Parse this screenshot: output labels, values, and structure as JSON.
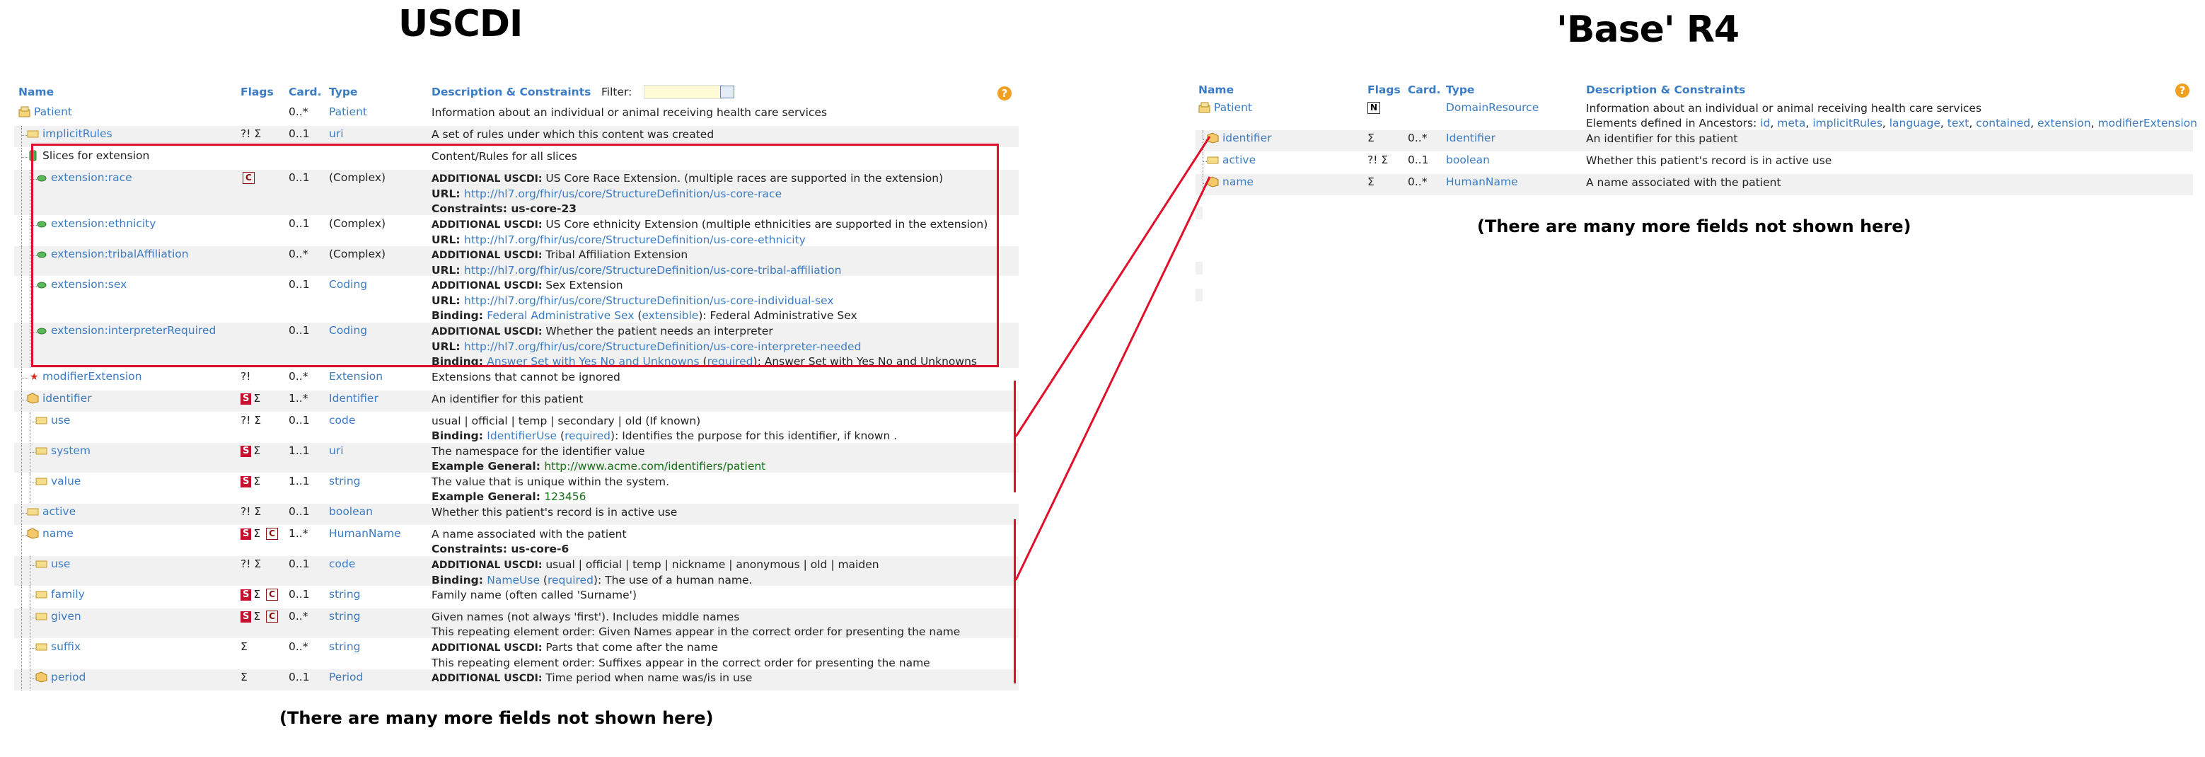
{
  "titles": {
    "left": "USCDI",
    "right": "'Base' R4"
  },
  "notes": {
    "left": "(There are many more fields not shown here)",
    "right": "(There are many more fields not shown here)"
  },
  "colors": {
    "link": "#3b7cc4",
    "highlight": "#e0102a",
    "flag_s": "#c8102e",
    "row_alt": "#f1f1f1"
  },
  "left_table": {
    "headers": {
      "name": "Name",
      "flags": "Flags",
      "card": "Card.",
      "type": "Type",
      "desc": "Description & Constraints",
      "filter": "Filter:"
    },
    "help_icon": "?",
    "rows": [
      {
        "name": "Patient",
        "icon": "resource-icon",
        "flags": "",
        "card": "0..*",
        "type": "Patient",
        "desc": [
          "Information about an individual or animal receiving health care services"
        ]
      },
      {
        "name": "implicitRules",
        "icon": "primitive-icon",
        "flags": "?! Σ",
        "card": "0..1",
        "type": "uri",
        "desc": [
          "A set of rules under which this content was created"
        ]
      },
      {
        "name": "Slices for extension",
        "icon": "slice-icon",
        "flags": "",
        "card": "",
        "type": "",
        "desc": [
          "Content/Rules for all slices"
        ]
      },
      {
        "name": "extension:race",
        "icon": "extension-icon",
        "flags": "C",
        "card": "0..1",
        "type": "(Complex)",
        "desc": [
          "ADDITIONAL USCDI: US Core Race Extension. (multiple races are supported in the extension)",
          "URL: http://hl7.org/fhir/us/core/StructureDefinition/us-core-race",
          "Constraints: us-core-23"
        ]
      },
      {
        "name": "extension:ethnicity",
        "icon": "extension-icon",
        "flags": "",
        "card": "0..1",
        "type": "(Complex)",
        "desc": [
          "ADDITIONAL USCDI: US Core ethnicity Extension (multiple ethnicities are supported in the extension)",
          "URL: http://hl7.org/fhir/us/core/StructureDefinition/us-core-ethnicity"
        ]
      },
      {
        "name": "extension:tribalAffiliation",
        "icon": "extension-icon",
        "flags": "",
        "card": "0..*",
        "type": "(Complex)",
        "desc": [
          "ADDITIONAL USCDI: Tribal Affiliation Extension",
          "URL: http://hl7.org/fhir/us/core/StructureDefinition/us-core-tribal-affiliation"
        ]
      },
      {
        "name": "extension:sex",
        "icon": "extension-icon",
        "flags": "",
        "card": "0..1",
        "type": "Coding",
        "desc": [
          "ADDITIONAL USCDI: Sex Extension",
          "URL: http://hl7.org/fhir/us/core/StructureDefinition/us-core-individual-sex",
          "Binding: Federal Administrative Sex (extensible): Federal Administrative Sex"
        ]
      },
      {
        "name": "extension:interpreterRequired",
        "icon": "extension-icon",
        "flags": "",
        "card": "0..1",
        "type": "Coding",
        "desc": [
          "ADDITIONAL USCDI: Whether the patient needs an interpreter",
          "URL: http://hl7.org/fhir/us/core/StructureDefinition/us-core-interpreter-needed",
          "Binding: Answer Set with Yes No and Unknowns (required): Answer Set with Yes No and Unknowns"
        ]
      },
      {
        "name": "modifierExtension",
        "icon": "modifier-icon",
        "flags": "?!",
        "card": "0..*",
        "type": "Extension",
        "desc": [
          "Extensions that cannot be ignored"
        ]
      },
      {
        "name": "identifier",
        "icon": "datatype-icon",
        "flags": "S Σ",
        "card": "1..*",
        "type": "Identifier",
        "desc": [
          "An identifier for this patient"
        ]
      },
      {
        "name": "use",
        "icon": "primitive-icon",
        "flags": "?! Σ",
        "card": "0..1",
        "type": "code",
        "desc": [
          "usual | official | temp | secondary | old (If known)",
          "Binding: IdentifierUse (required): Identifies the purpose for this identifier, if known ."
        ]
      },
      {
        "name": "system",
        "icon": "primitive-icon",
        "flags": "S Σ",
        "card": "1..1",
        "type": "uri",
        "desc": [
          "The namespace for the identifier value",
          "Example General: http://www.acme.com/identifiers/patient"
        ]
      },
      {
        "name": "value",
        "icon": "primitive-icon",
        "flags": "S Σ",
        "card": "1..1",
        "type": "string",
        "desc": [
          "The value that is unique within the system.",
          "Example General: 123456"
        ]
      },
      {
        "name": "active",
        "icon": "primitive-icon",
        "flags": "?! Σ",
        "card": "0..1",
        "type": "boolean",
        "desc": [
          "Whether this patient's record is in active use"
        ]
      },
      {
        "name": "name",
        "icon": "datatype-icon",
        "flags": "S Σ C",
        "card": "1..*",
        "type": "HumanName",
        "desc": [
          "A name associated with the patient",
          "Constraints: us-core-6"
        ]
      },
      {
        "name": "use",
        "icon": "primitive-icon",
        "flags": "?! Σ",
        "card": "0..1",
        "type": "code",
        "desc": [
          "ADDITIONAL USCDI: usual | official | temp | nickname | anonymous | old | maiden",
          "Binding: NameUse (required): The use of a human name."
        ]
      },
      {
        "name": "family",
        "icon": "primitive-icon",
        "flags": "S Σ C",
        "card": "0..1",
        "type": "string",
        "desc": [
          "Family name (often called 'Surname')"
        ]
      },
      {
        "name": "given",
        "icon": "primitive-icon",
        "flags": "S Σ C",
        "card": "0..*",
        "type": "string",
        "desc": [
          "Given names (not always 'first'). Includes middle names",
          "This repeating element order: Given Names appear in the correct order for presenting the name"
        ]
      },
      {
        "name": "suffix",
        "icon": "primitive-icon",
        "flags": "Σ",
        "card": "0..*",
        "type": "string",
        "desc": [
          "ADDITIONAL USCDI: Parts that come after the name",
          "This repeating element order: Suffixes appear in the correct order for presenting the name"
        ]
      },
      {
        "name": "period",
        "icon": "datatype-icon",
        "flags": "Σ",
        "card": "0..1",
        "type": "Period",
        "desc": [
          "ADDITIONAL USCDI: Time period when name was/is in use"
        ]
      }
    ]
  },
  "right_table": {
    "headers": {
      "name": "Name",
      "flags": "Flags",
      "card": "Card.",
      "type": "Type",
      "desc": "Description & Constraints"
    },
    "help_icon": "?",
    "rows": [
      {
        "name": "Patient",
        "icon": "resource-icon",
        "flags": "N",
        "card": "",
        "type": "DomainResource",
        "desc": [
          "Information about an individual or animal receiving health care services"
        ],
        "ancestors_label": "Elements defined in Ancestors:",
        "ancestors": [
          "id",
          "meta",
          "implicitRules",
          "language",
          "text",
          "contained",
          "extension",
          "modifierExtension"
        ]
      },
      {
        "name": "identifier",
        "icon": "datatype-icon",
        "flags": "Σ",
        "card": "0..*",
        "type": "Identifier",
        "desc": [
          "An identifier for this patient"
        ]
      },
      {
        "name": "active",
        "icon": "primitive-icon",
        "flags": "?! Σ",
        "card": "0..1",
        "type": "boolean",
        "desc": [
          "Whether this patient's record is in active use"
        ]
      },
      {
        "name": "name",
        "icon": "datatype-icon",
        "flags": "Σ",
        "card": "0..*",
        "type": "HumanName",
        "desc": [
          "A name associated with the patient"
        ]
      }
    ]
  }
}
